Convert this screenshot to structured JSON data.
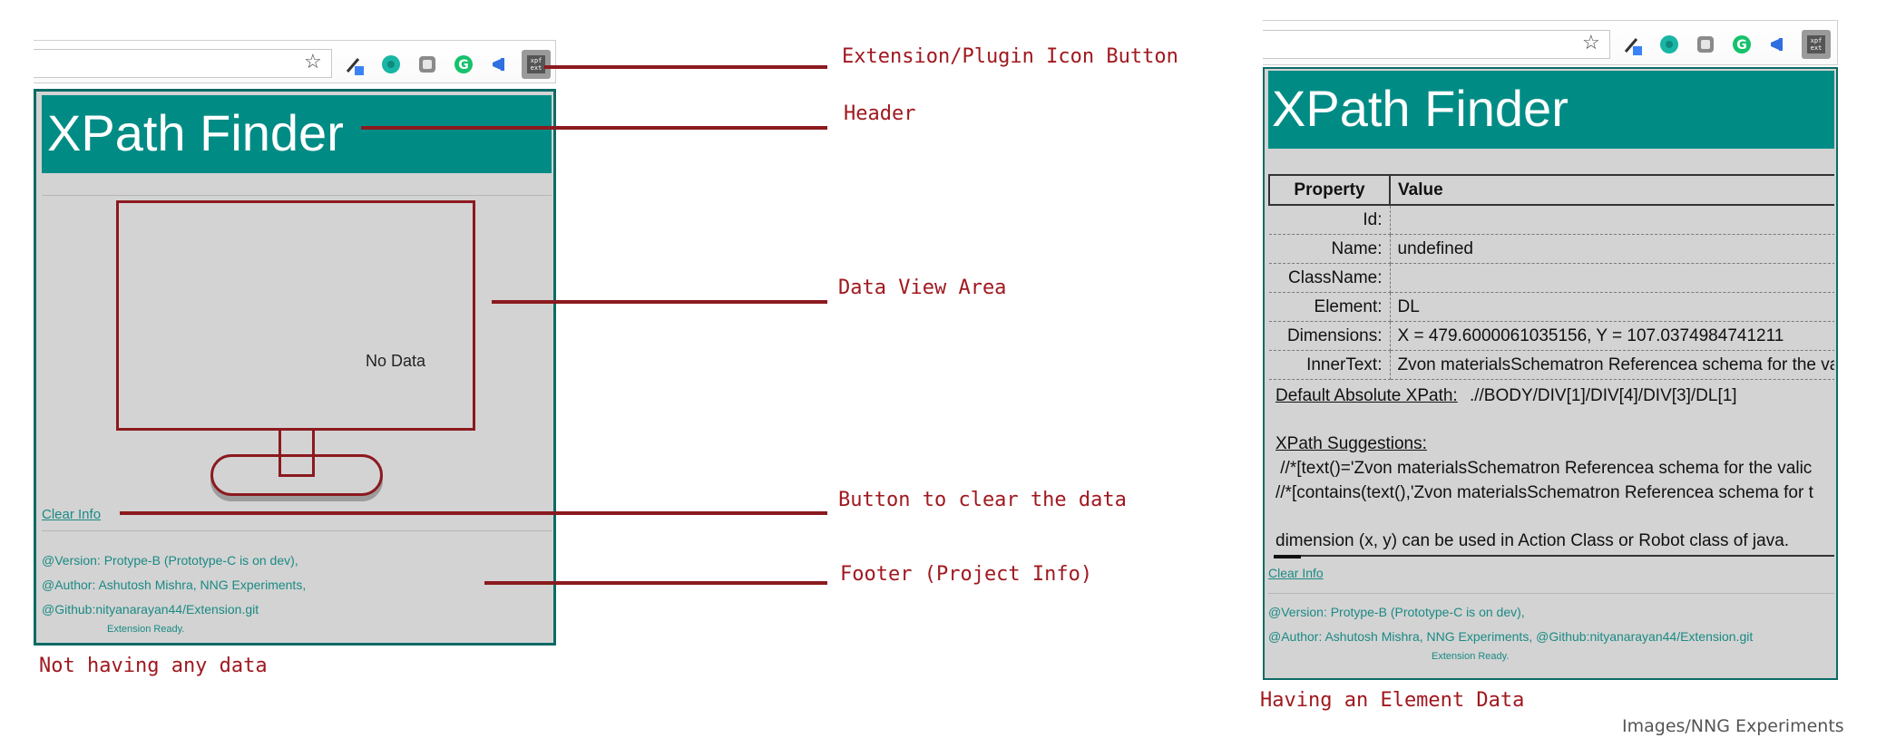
{
  "left_panel": {
    "header_title": "XPath Finder",
    "no_data_text": "No Data",
    "clear_info_label": "Clear Info",
    "footer": {
      "version": "@Version: Protype-B (Prototype-C is on dev),",
      "author": "@Author: Ashutosh Mishra,   NNG Experiments,",
      "github": "@Github:nityanarayan44/Extension.git",
      "status": "Extension Ready."
    },
    "caption": "Not having any data"
  },
  "annotations": {
    "extension_icon": "Extension/Plugin Icon Button",
    "header": "Header",
    "data_view": "Data View Area",
    "clear_button": "Button to clear the data",
    "footer": "Footer (Project Info)"
  },
  "right_panel": {
    "header_title": "XPath Finder",
    "table": {
      "headers": [
        "Property",
        "Value"
      ],
      "rows": [
        {
          "key": "Id:",
          "value": ""
        },
        {
          "key": "Name:",
          "value": "undefined"
        },
        {
          "key": "ClassName:",
          "value": ""
        },
        {
          "key": "Element:",
          "value": "DL"
        },
        {
          "key": "Dimensions:",
          "value": "X = 479.6000061035156, Y = 107.0374984741211"
        },
        {
          "key": "InnerText:",
          "value": "Zvon materialsSchematron Referencea schema for the va"
        }
      ]
    },
    "default_xpath_label": "Default Absolute XPath:",
    "default_xpath_value": ".//BODY/DIV[1]/DIV[4]/DIV[3]/DL[1]",
    "suggestions_label": "XPath Suggestions:",
    "suggestions": [
      " //*[text()='Zvon materialsSchematron Referencea schema for the valic",
      "//*[contains(text(),'Zvon materialsSchematron Referencea schema for t"
    ],
    "dimension_note": "dimension (x, y) can be used in Action Class or Robot class of java.",
    "clear_info_label": "Clear Info",
    "footer": {
      "version": "@Version: Protype-B (Prototype-C is on dev),",
      "author_github": "@Author: Ashutosh Mishra,   NNG Experiments, @Github:nityanarayan44/Extension.git",
      "status": "Extension Ready."
    },
    "caption": "Having an Element Data"
  },
  "watermark": "Images/NNG Experiments",
  "toolbar_icons": [
    "star-icon",
    "eyedropper-icon",
    "teal-circle-icon",
    "gray-square-icon",
    "grammarly-icon",
    "megaphone-icon",
    "xpath-extension-icon"
  ],
  "colors": {
    "teal": "#008c85",
    "annotation_red": "#a0181f",
    "panel_gray": "#d3d3d3"
  }
}
